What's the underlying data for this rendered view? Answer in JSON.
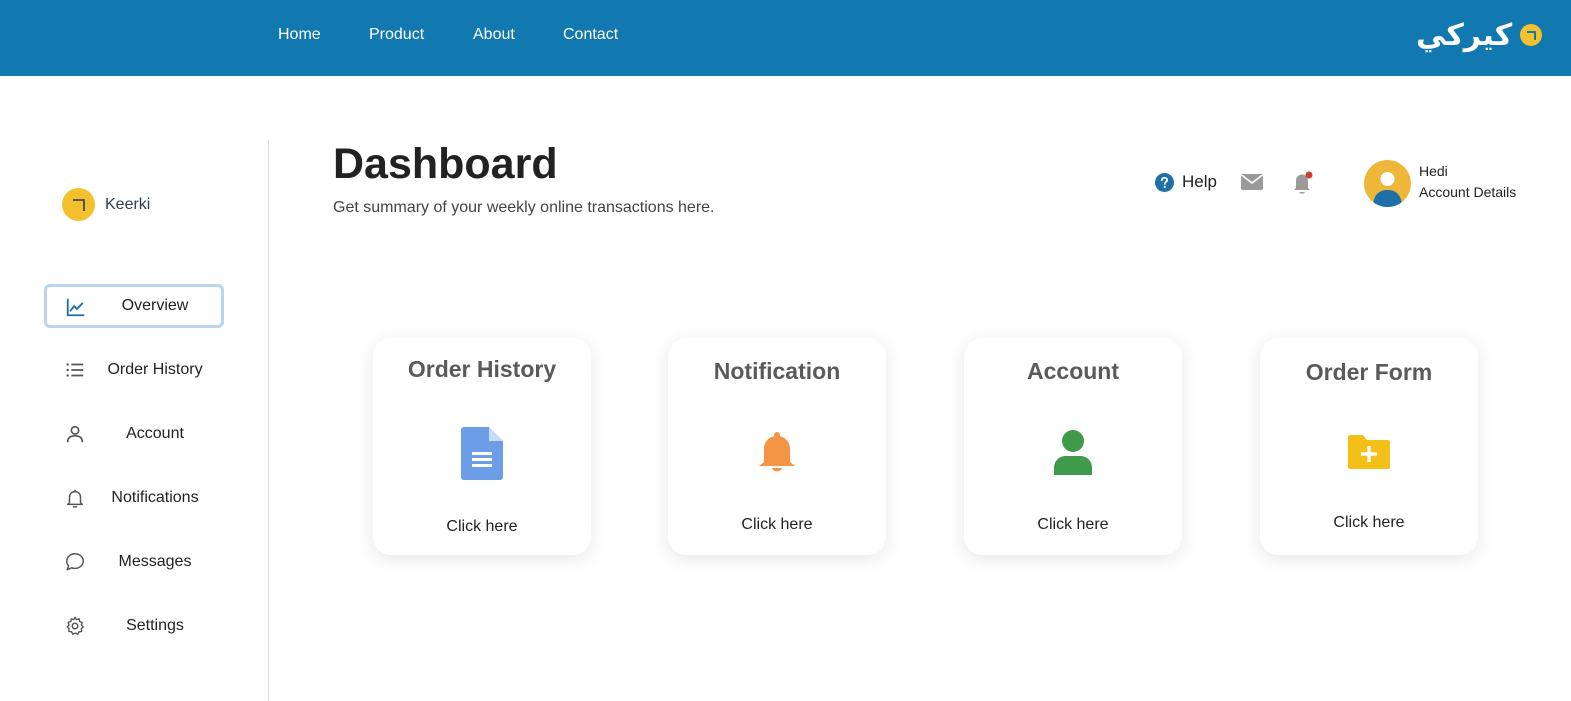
{
  "topbar": {
    "nav": [
      "Home",
      "Product",
      "About",
      "Contact"
    ],
    "brand_text": "كيركي",
    "bg_color": "#1278b0"
  },
  "sidebar": {
    "logo_name": "Keerki",
    "items": [
      {
        "label": "Overview",
        "icon": "chart-line-icon",
        "active": true
      },
      {
        "label": "Order History",
        "icon": "list-icon",
        "active": false
      },
      {
        "label": "Account",
        "icon": "user-icon",
        "active": false
      },
      {
        "label": "Notifications",
        "icon": "bell-icon",
        "active": false
      },
      {
        "label": "Messages",
        "icon": "chat-icon",
        "active": false
      },
      {
        "label": "Settings",
        "icon": "gear-icon",
        "active": false
      }
    ]
  },
  "header": {
    "title": "Dashboard",
    "subtitle": "Get summary of your weekly online transactions here.",
    "help_label": "Help",
    "user_name": "Hedi",
    "user_link": "Account Details"
  },
  "cards": [
    {
      "title": "Order History",
      "cta": "Click here",
      "icon": "document-icon",
      "color": "#6c9ee8"
    },
    {
      "title": "Notification",
      "cta": "Click here",
      "icon": "bell-icon",
      "color": "#f39545"
    },
    {
      "title": "Account",
      "cta": "Click here",
      "icon": "user-icon",
      "color": "#3f9b49"
    },
    {
      "title": "Order Form",
      "cta": "Click here",
      "icon": "folder-plus-icon",
      "color": "#f4c017"
    }
  ]
}
